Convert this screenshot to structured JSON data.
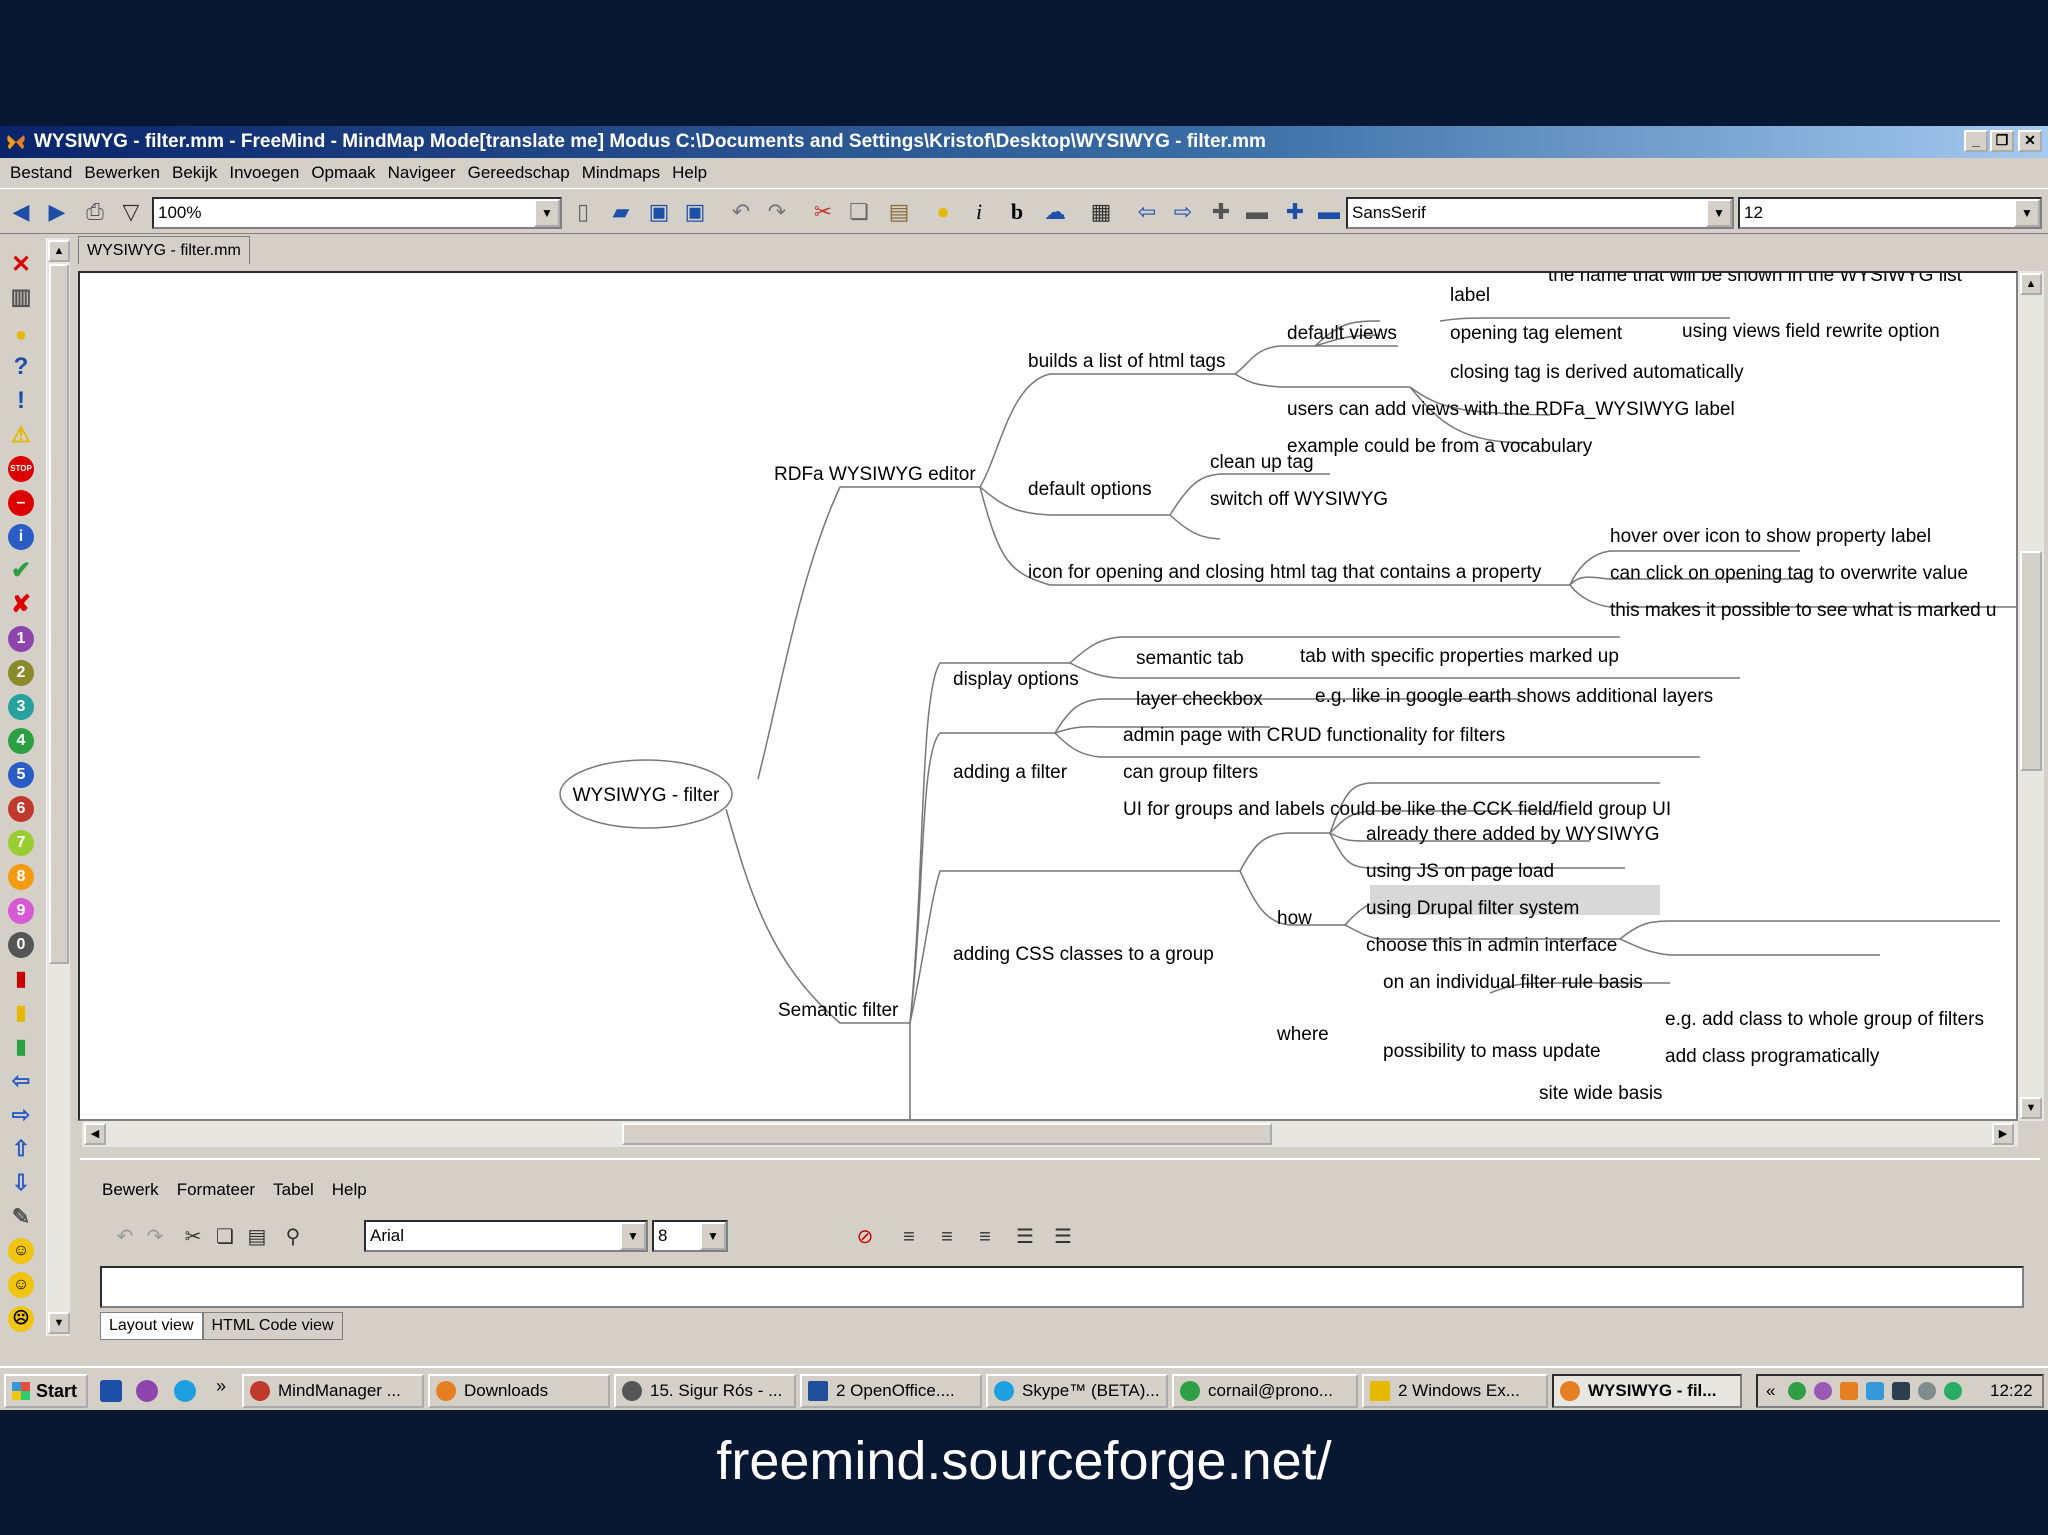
{
  "window": {
    "title": "WYSIWYG - filter.mm - FreeMind - MindMap Mode[translate me] Modus C:\\Documents and Settings\\Kristof\\Desktop\\WYSIWYG - filter.mm"
  },
  "menubar": [
    "Bestand",
    "Bewerken",
    "Bekijk",
    "Invoegen",
    "Opmaak",
    "Navigeer",
    "Gereedschap",
    "Mindmaps",
    "Help"
  ],
  "toolbar": {
    "zoom": "100%",
    "font": "SansSerif",
    "font_size": "12"
  },
  "map_tab": "WYSIWYG - filter.mm",
  "mindmap": {
    "root": "WYSIWYG - filter",
    "nodes": {
      "rdfa": "RDFa WYSIWYG editor",
      "builds": "builds a list of html tags",
      "default_views": "default views",
      "label": "label",
      "label_desc": "the name that will be shown in the WYSIWYG list",
      "opening_tag": "opening tag element",
      "views_field": "using views field rewrite option",
      "closing_tag": "closing tag is derived automatically",
      "users_add": "users can add views with the RDFa_WYSIWYG label",
      "example_vocab": "example could be from a vocabulary",
      "default_options": "default options",
      "clean_up": "clean up tag",
      "switch_off": "switch off WYSIWYG",
      "icon_for": "icon for opening and closing html tag that contains a property",
      "hover_over": "hover over icon to show property label",
      "can_click": "can click on opening tag to overwrite value",
      "this_makes": "this makes it possible to see what is marked u",
      "semantic_filter": "Semantic filter",
      "display_options": "display options",
      "semantic_tab": "semantic tab",
      "tab_with": "tab with specific properties marked up",
      "layer_checkbox": "layer checkbox",
      "eg_google": "e.g. like in google earth shows additional layers",
      "adding_filter": "adding a filter",
      "admin_page": "admin page with CRUD functionality for filters",
      "can_group": "can group filters",
      "ui_groups": "UI for groups and labels could be like the CCK field/field group UI",
      "adding_css": "adding CSS classes to a group",
      "how": "how",
      "already_there": "already there added by WYSIWYG",
      "using_js": "using JS on page load",
      "using_drupal": "using Drupal filter system",
      "choose_this": "choose this in admin interface",
      "where": "where",
      "individual": "on an individual filter rule basis",
      "possibility": "possibility to mass update",
      "eg_add_class": "e.g. add class to whole group of filters",
      "add_class_prog": "add class programatically",
      "site_wide": "site wide basis"
    }
  },
  "editor": {
    "menu": [
      "Bewerk",
      "Formateer",
      "Tabel",
      "Help"
    ],
    "font": "Arial",
    "size": "8",
    "tabs": [
      "Layout view",
      "HTML Code view"
    ]
  },
  "taskbar": {
    "start": "Start",
    "overflow": "»",
    "tasks": [
      {
        "label": "MindManager ...",
        "color": "#c0392b"
      },
      {
        "label": "Downloads",
        "color": "#e67e22"
      },
      {
        "label": "15. Sigur Rós - ...",
        "color": "#555555"
      },
      {
        "label": "2 OpenOffice....",
        "color": "#1e4f9a"
      },
      {
        "label": "Skype™ (BETA)...",
        "color": "#1ea0e0"
      },
      {
        "label": "cornail@prono...",
        "color": "#2ea043"
      },
      {
        "label": "2 Windows Ex...",
        "color": "#e6b800"
      },
      {
        "label": "WYSIWYG - fil...",
        "color": "#e67e22"
      }
    ],
    "tray_chevron": "«",
    "clock": "12:22"
  },
  "footer": "freemind.sourceforge.net/"
}
